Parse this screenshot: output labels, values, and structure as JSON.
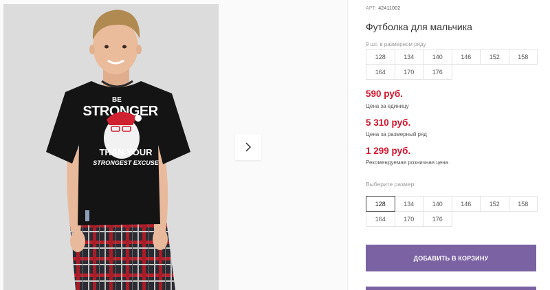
{
  "product": {
    "sku_label": "АРТ:",
    "sku_value": "42411002",
    "title": "Футболка для мальчика",
    "pack_note": "9 шт. в размерном ряду"
  },
  "pack_sizes": [
    [
      "128",
      "134",
      "140",
      "146",
      "152",
      "158"
    ],
    [
      "164",
      "170",
      "176"
    ]
  ],
  "prices": {
    "unit_price": "590 руб.",
    "unit_label": "Цена за единицу",
    "pack_price": "5 310 руб.",
    "pack_label": "Цена за размерный ряд",
    "retail_price": "1 299 руб.",
    "retail_label": "Рекомендуемая розничная цена"
  },
  "size_selector": {
    "label": "Выберите размер:",
    "rows": [
      [
        "128",
        "134",
        "140",
        "146",
        "152",
        "158"
      ],
      [
        "164",
        "170",
        "176"
      ]
    ],
    "selected": "128"
  },
  "cart_button_label": "ДОБАВИТЬ В КОРЗИНУ",
  "shirt_print": {
    "line1": "BE",
    "line2": "STRONGER",
    "line3": "THAN YOUR",
    "line4": "STRONGEST EXCUSE"
  },
  "colors": {
    "price": "#d2142c",
    "accent": "#7a62a3"
  }
}
